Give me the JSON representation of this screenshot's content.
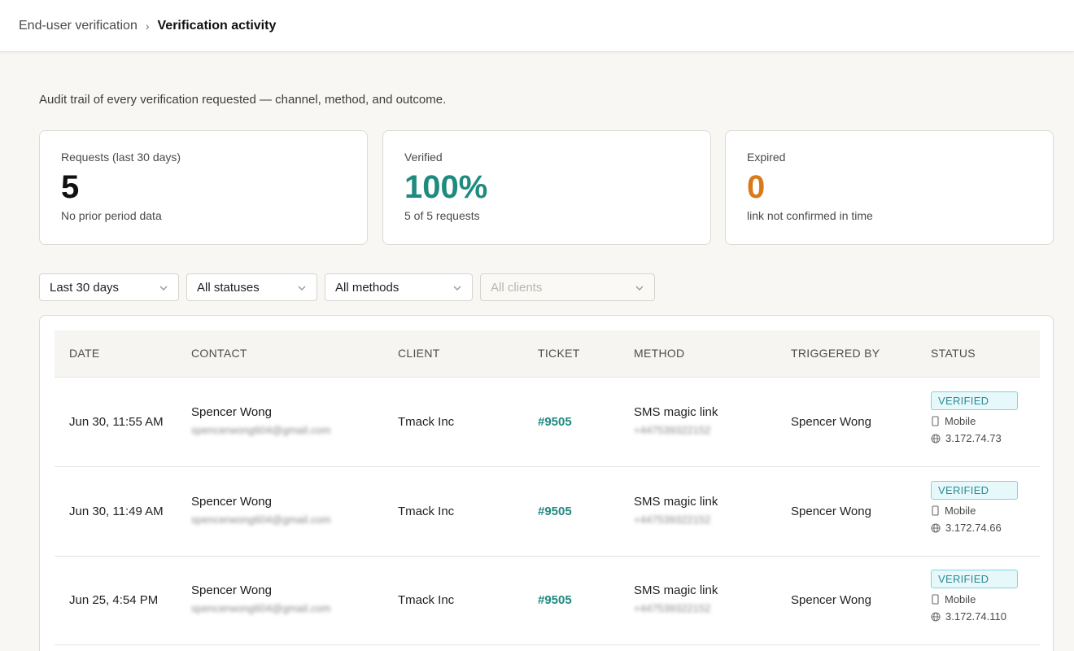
{
  "breadcrumb": {
    "parent": "End-user verification",
    "separator": "›",
    "current": "Verification activity"
  },
  "subtitle": "Audit trail of every verification requested — channel, method, and outcome.",
  "stats": [
    {
      "label": "Requests (last 30 days)",
      "value": "5",
      "note": "No prior period data",
      "color": "#111111"
    },
    {
      "label": "Verified",
      "value": "100%",
      "note": "5 of 5 requests",
      "color": "#1f8a80"
    },
    {
      "label": "Expired",
      "value": "0",
      "note": "link not confirmed in time",
      "color": "#d97a1a"
    }
  ],
  "filters": {
    "period": "Last 30 days",
    "status": "All statuses",
    "method": "All methods",
    "client": "All clients"
  },
  "table": {
    "columns": [
      "DATE",
      "CONTACT",
      "CLIENT",
      "TICKET",
      "METHOD",
      "TRIGGERED BY",
      "STATUS"
    ],
    "rows": [
      {
        "date": "Jun 30, 11:55 AM",
        "contact_name": "Spencer Wong",
        "contact_email": "spencerwong604@gmail.com",
        "client": "Tmack Inc",
        "ticket": "#9505",
        "method": "SMS magic link",
        "phone": "+447539322152",
        "triggered_by": "Spencer Wong",
        "status": "VERIFIED",
        "device": "Mobile",
        "ip": "3.172.74.73"
      },
      {
        "date": "Jun 30, 11:49 AM",
        "contact_name": "Spencer Wong",
        "contact_email": "spencerwong604@gmail.com",
        "client": "Tmack Inc",
        "ticket": "#9505",
        "method": "SMS magic link",
        "phone": "+447539322152",
        "triggered_by": "Spencer Wong",
        "status": "VERIFIED",
        "device": "Mobile",
        "ip": "3.172.74.66"
      },
      {
        "date": "Jun 25, 4:54 PM",
        "contact_name": "Spencer Wong",
        "contact_email": "spencerwong604@gmail.com",
        "client": "Tmack Inc",
        "ticket": "#9505",
        "method": "SMS magic link",
        "phone": "+447539322152",
        "triggered_by": "Spencer Wong",
        "status": "VERIFIED",
        "device": "Mobile",
        "ip": "3.172.74.110"
      }
    ]
  },
  "colors": {
    "accent": "#1f8a80",
    "warning": "#d97a1a",
    "badge": "#2b8a96"
  }
}
